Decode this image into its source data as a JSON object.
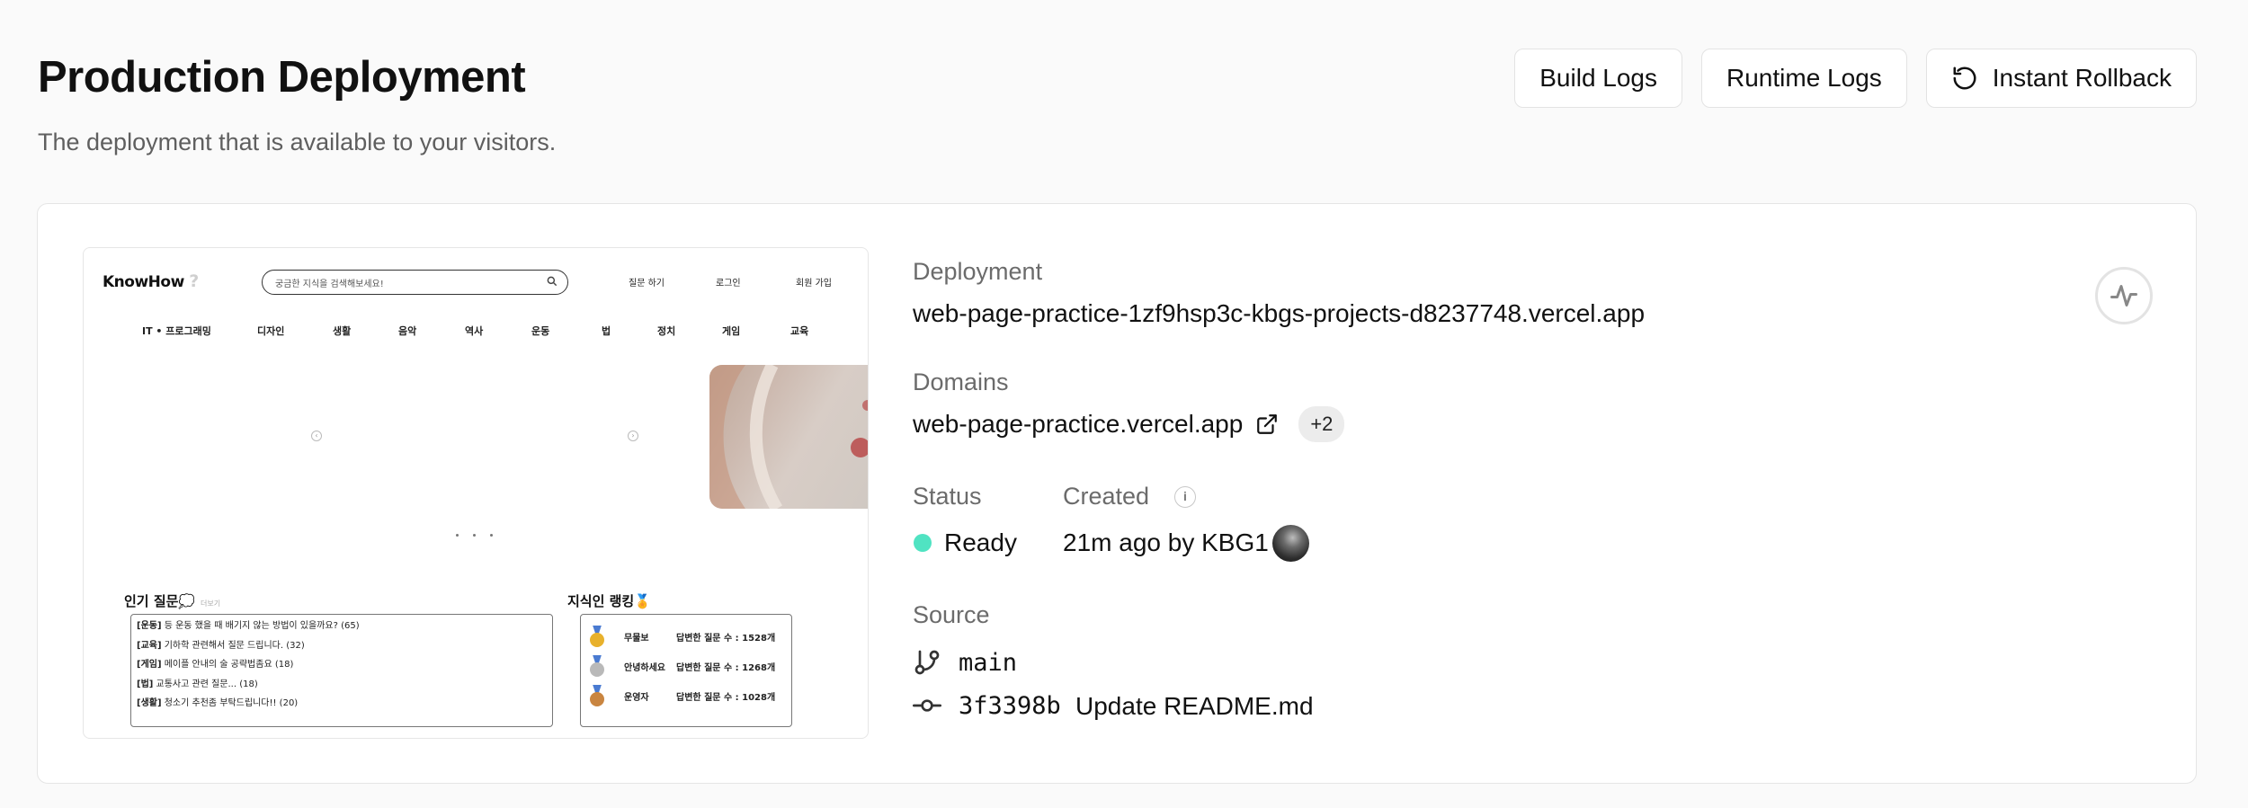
{
  "header": {
    "title": "Production Deployment",
    "subtitle": "The deployment that is available to your visitors."
  },
  "actions": {
    "build_logs": "Build Logs",
    "runtime_logs": "Runtime Logs",
    "instant_rollback": "Instant Rollback",
    "rollback_icon": "rotate-ccw-icon"
  },
  "preview": {
    "logo": "KnowHow",
    "logo_mark": "?",
    "search_placeholder": "궁금한 지식을 검색해보세요!",
    "top_links": [
      "질문 하기",
      "로그인",
      "회원 가입"
    ],
    "nav": [
      "IT • 프로그래밍",
      "디자인",
      "생활",
      "음악",
      "역사",
      "운동",
      "법",
      "정치",
      "게임",
      "교육"
    ],
    "popular_title": "인기 질문💭",
    "popular_more": "더보기",
    "questions": [
      {
        "tag": "[운동]",
        "text": " 등 운동 했을 때 배기지 않는 방법이 있을까요? (65)"
      },
      {
        "tag": "[교육]",
        "text": " 기하학 관련해서 질문 드립니다. (32)"
      },
      {
        "tag": "[게임]",
        "text": " 메이플 안내의 술 공략법좀요 (18)"
      },
      {
        "tag": "[법]",
        "text": " 교통사고 관련 질문... (18)"
      },
      {
        "tag": "[생활]",
        "text": " 청소기 추천좀 부탁드립니다!! (20)"
      }
    ],
    "ranking_title": "지식인 랭킹🏅",
    "ranking": [
      {
        "name": "무물보",
        "count": "답변한 질문 수 : 1528개",
        "medal": "#e8b12c"
      },
      {
        "name": "안녕하세요",
        "count": "답변한 질문 수 : 1268개",
        "medal": "#b9b9b9"
      },
      {
        "name": "운영자",
        "count": "답변한 질문 수 : 1028개",
        "medal": "#c98540"
      }
    ],
    "carousel_prev": "‹",
    "carousel_next": "›"
  },
  "deployment": {
    "label": "Deployment",
    "url": "web-page-practice-1zf9hsp3c-kbgs-projects-d8237748.vercel.app"
  },
  "domains": {
    "label": "Domains",
    "primary": "web-page-practice.vercel.app",
    "extra": "+2"
  },
  "status": {
    "label": "Status",
    "value": "Ready",
    "color": "#50e3c2"
  },
  "created": {
    "label": "Created",
    "info": "i",
    "value": "21m ago by KBG1"
  },
  "source": {
    "label": "Source",
    "branch": "main",
    "commit_hash": "3f3398b",
    "commit_message": "Update README.md"
  }
}
